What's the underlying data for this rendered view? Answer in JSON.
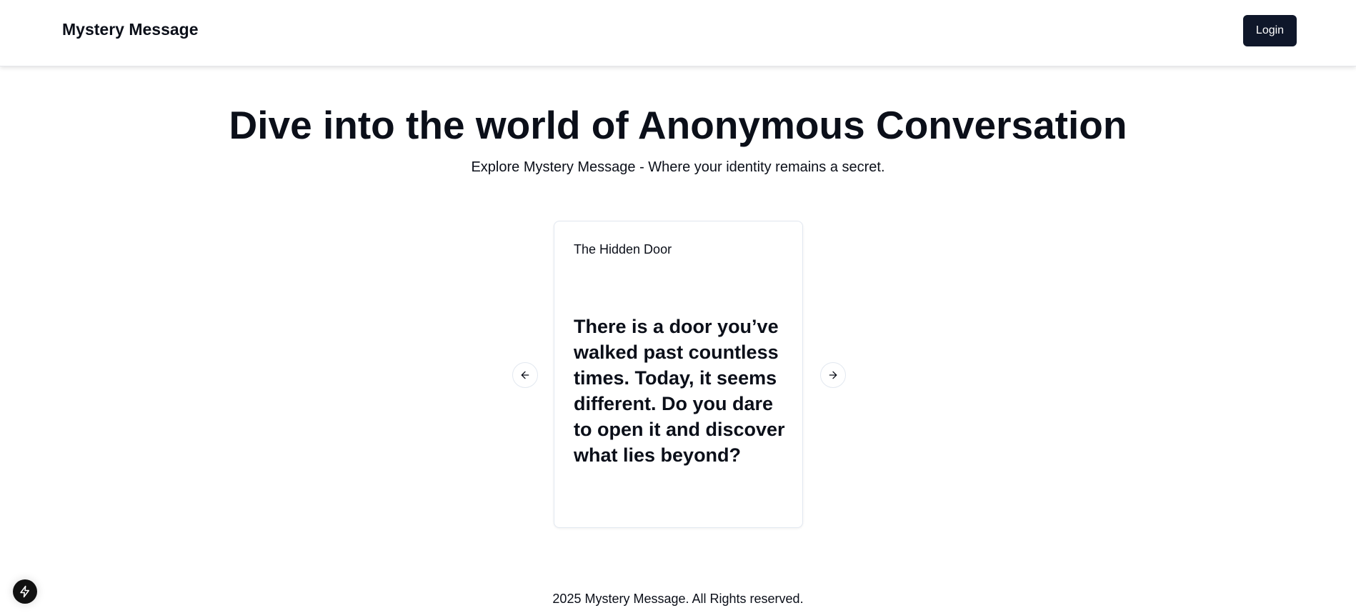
{
  "header": {
    "brand": "Mystery Message",
    "login_label": "Login"
  },
  "hero": {
    "title": "Dive into the world of Anonymous Conversation",
    "subtitle": "Explore Mystery Message - Where your identity remains a secret."
  },
  "carousel": {
    "card": {
      "title": "The Hidden Door",
      "body": "There is a door you’ve walked past countless times. Today, it seems different. Do you dare to open it and discover what lies beyond?"
    },
    "prev_icon": "arrow-left-icon",
    "next_icon": "arrow-right-icon"
  },
  "footer": {
    "text": "2025 Mystery Message. All Rights reserved."
  },
  "dev_badge": {
    "icon": "lightning-bolt-icon"
  },
  "colors": {
    "primary": "#0f172a",
    "text": "#0b0f19",
    "border": "#e2e8f0"
  }
}
